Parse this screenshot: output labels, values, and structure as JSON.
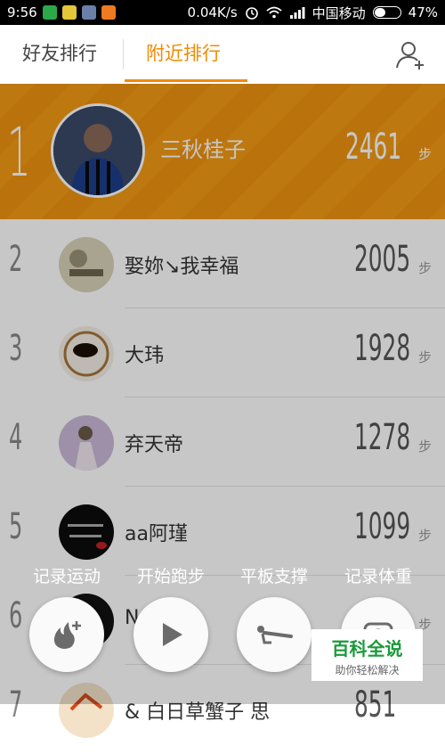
{
  "status_bar": {
    "time": "9:56",
    "network_speed": "0.04K/s",
    "carrier": "中国移动",
    "battery": "47%",
    "battery_level": 0.47
  },
  "tabs": [
    {
      "label": "好友排行",
      "active": false
    },
    {
      "label": "附近排行",
      "active": true
    }
  ],
  "accent_color": "#f38a00",
  "ranking": [
    {
      "rank": "1",
      "name": "三秋桂子",
      "steps": "2461",
      "unit": "步"
    },
    {
      "rank": "2",
      "name": "娶妳↘我幸福",
      "steps": "2005",
      "unit": "步"
    },
    {
      "rank": "3",
      "name": "大玮",
      "steps": "1928",
      "unit": "步"
    },
    {
      "rank": "4",
      "name": "弃天帝",
      "steps": "1278",
      "unit": "步"
    },
    {
      "rank": "5",
      "name": "aa阿瑾",
      "steps": "1099",
      "unit": "步"
    },
    {
      "rank": "6",
      "name": "N",
      "steps": "",
      "unit": "步"
    },
    {
      "rank": "7",
      "name": "& 白日草蟹子 思",
      "steps": "851",
      "unit": ""
    }
  ],
  "actions": [
    {
      "label": "记录运动",
      "icon": "flame-plus-icon"
    },
    {
      "label": "开始跑步",
      "icon": "play-icon"
    },
    {
      "label": "平板支撑",
      "icon": "plank-icon"
    },
    {
      "label": "记录体重",
      "icon": "scale-icon"
    }
  ],
  "watermark": {
    "title": "百科全说",
    "subtitle": "助你轻松解决"
  }
}
